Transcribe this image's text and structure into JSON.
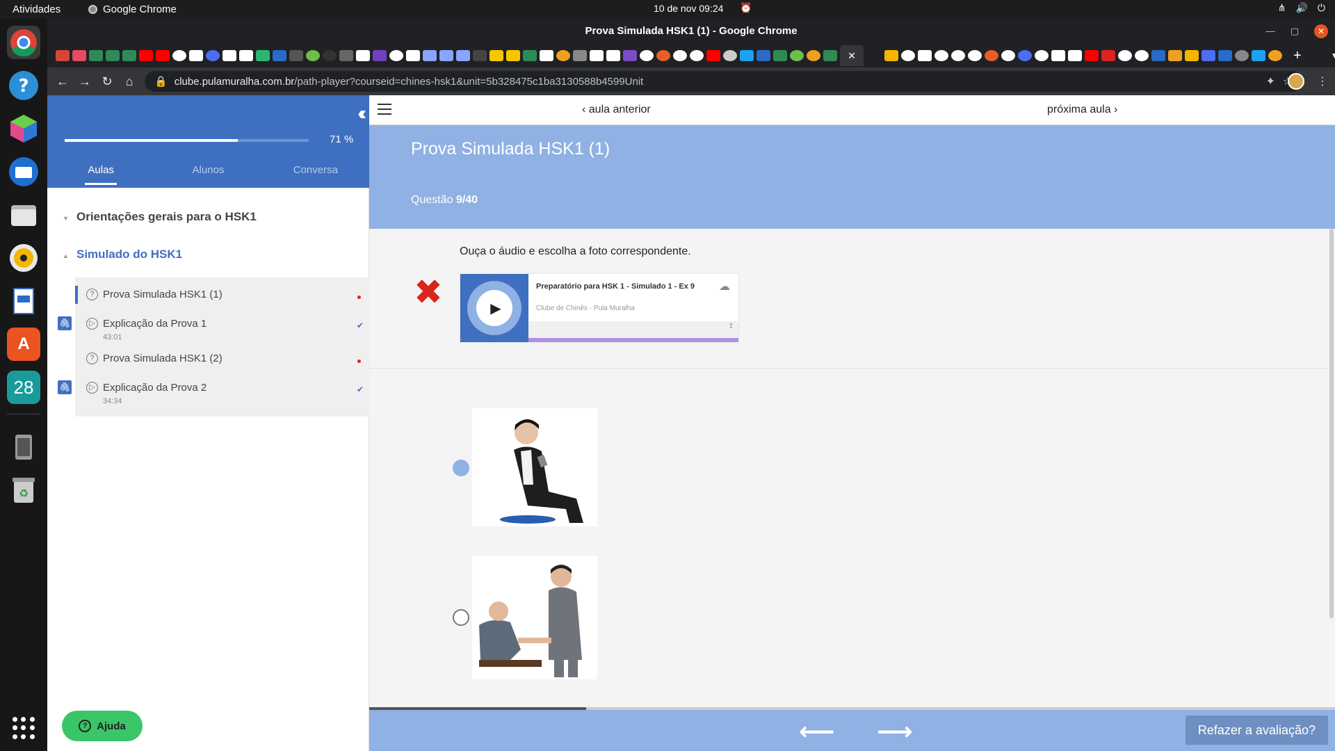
{
  "os": {
    "activities": "Atividades",
    "app_name": "Google Chrome",
    "clock": "10 de nov  09:24"
  },
  "window": {
    "title": "Prova Simulada HSK1 (1) - Google Chrome"
  },
  "browser": {
    "url_host": "clube.pulamuralha.com.br",
    "url_path": "/path-player?courseid=chines-hsk1&unit=5b328475c1ba3130588b4599Unit",
    "new_tab": "+"
  },
  "sidebar": {
    "progress_percent": 71,
    "progress_label": "71 %",
    "tabs": [
      "Aulas",
      "Alunos",
      "Conversa"
    ],
    "sections": [
      {
        "title": "Orientações gerais para o HSK1",
        "expanded": false
      },
      {
        "title": "Simulado do HSK1",
        "expanded": true
      }
    ],
    "lessons": [
      {
        "title": "Prova Simulada HSK1 (1)",
        "duration": "",
        "status": "incomplete"
      },
      {
        "title": "Explicação da Prova 1",
        "duration": "43:01",
        "status": "complete"
      },
      {
        "title": "Prova Simulada HSK1 (2)",
        "duration": "",
        "status": "incomplete"
      },
      {
        "title": "Explicação da Prova 2",
        "duration": "34:34",
        "status": "complete"
      }
    ],
    "help_label": "Ajuda"
  },
  "main": {
    "prev_lesson": "aula anterior",
    "next_lesson": "próxima aula",
    "title": "Prova Simulada HSK1 (1)",
    "question_label": "Questão",
    "question_number": "9/40",
    "instruction": "Ouça o áudio e escolha a foto correspondente.",
    "player": {
      "track_title": "Preparatório para HSK 1 - Simulado 1 - Ex 9",
      "artist": "Clube de Chinês - Pula Muralha"
    },
    "options": [
      {
        "name": "man-reading-phone",
        "selected": true
      },
      {
        "name": "men-shaking-hands",
        "selected": false
      },
      {
        "name": "woman",
        "selected": false
      }
    ],
    "redo_label": "Refazer a avaliação?"
  }
}
